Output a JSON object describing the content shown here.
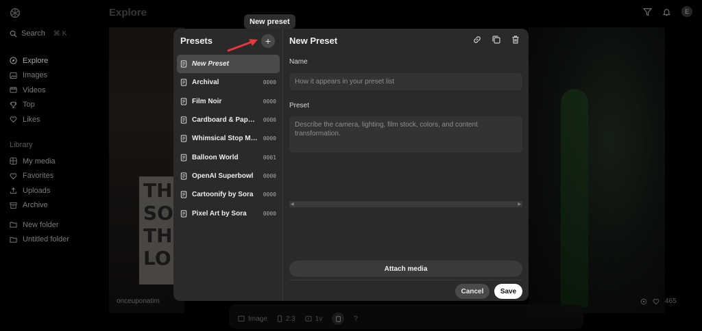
{
  "sidebar": {
    "search_label": "Search",
    "search_shortcut": "⌘ K",
    "nav": [
      {
        "label": "Explore",
        "icon": "compass-icon",
        "active": true
      },
      {
        "label": "Images",
        "icon": "image-icon"
      },
      {
        "label": "Videos",
        "icon": "video-icon"
      },
      {
        "label": "Top",
        "icon": "trophy-icon"
      },
      {
        "label": "Likes",
        "icon": "heart-icon"
      }
    ],
    "library_label": "Library",
    "library": [
      {
        "label": "My media",
        "icon": "grid-icon"
      },
      {
        "label": "Favorites",
        "icon": "heart-icon"
      },
      {
        "label": "Uploads",
        "icon": "upload-icon"
      },
      {
        "label": "Archive",
        "icon": "archive-icon"
      }
    ],
    "folders": [
      {
        "label": "New folder",
        "icon": "folder-icon"
      },
      {
        "label": "Untitled folder",
        "icon": "folder-icon"
      }
    ]
  },
  "header": {
    "title": "Explore",
    "avatar_initial": "E"
  },
  "background": {
    "card_user": "onceuponatim",
    "card_likes": "465",
    "sign_text": "THE SO TH LO"
  },
  "composer": {
    "type_label": "Image",
    "ratio_label": "2:3",
    "variations_label": "1v",
    "help_label": "?"
  },
  "tooltip": {
    "text": "New preset"
  },
  "modal": {
    "presets_title": "Presets",
    "add_label": "+",
    "presets": [
      {
        "name": "New Preset",
        "count": "",
        "selected": true
      },
      {
        "name": "Archival",
        "count": "0000"
      },
      {
        "name": "Film Noir",
        "count": "0000"
      },
      {
        "name": "Cardboard & Papercraft",
        "count": "0000"
      },
      {
        "name": "Whimsical Stop Motion",
        "count": "0000"
      },
      {
        "name": "Balloon World",
        "count": "0001"
      },
      {
        "name": "OpenAI Superbowl",
        "count": "0000"
      },
      {
        "name": "Cartoonify by Sora",
        "count": "0000"
      },
      {
        "name": "Pixel Art by Sora",
        "count": "0000"
      }
    ],
    "editor_title": "New Preset",
    "name_label": "Name",
    "name_placeholder": "How it appears in your preset list",
    "name_value": "",
    "preset_label": "Preset",
    "preset_placeholder": "Describe the camera, lighting, film stock, colors, and content transformation.",
    "attach_label": "Attach media",
    "cancel_label": "Cancel",
    "save_label": "Save"
  },
  "colors": {
    "background": "#000000",
    "modal": "#2a2a2a",
    "input": "#333333",
    "selected_item": "#4a4a4a",
    "save_button": "#ffffff",
    "annotation_arrow": "#e8373a"
  }
}
